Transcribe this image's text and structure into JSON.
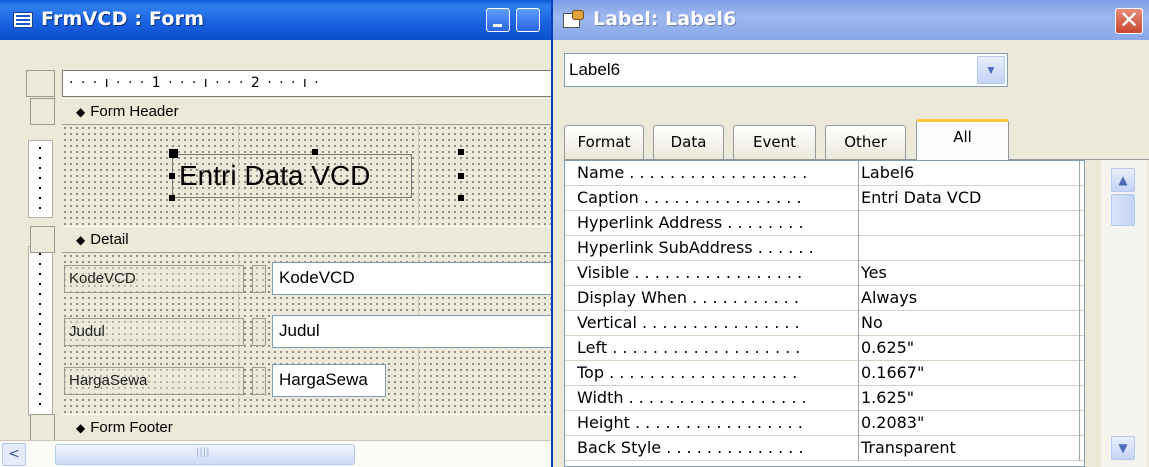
{
  "form_window": {
    "title": "FrmVCD : Form",
    "ruler_text": "· · · ı · · · 1 · · · ı · · · 2 · · · ı ·",
    "sections": {
      "header": "Form Header",
      "detail": "Detail",
      "footer": "Form Footer"
    },
    "header_label": "Entri Data VCD",
    "fields": [
      {
        "label": "KodeVCD",
        "textbox": "KodeVCD"
      },
      {
        "label": "Judul",
        "textbox": "Judul"
      },
      {
        "label": "HargaSewa",
        "textbox": "HargaSewa"
      }
    ],
    "section_arrow": "◆",
    "scroll_left": "<"
  },
  "property_sheet": {
    "title": "Label: Label6",
    "close_glyph": "✕",
    "selected_object": "Label6",
    "tabs": [
      "Format",
      "Data",
      "Event",
      "Other",
      "All"
    ],
    "active_tab": "All",
    "properties": [
      {
        "name": "Name . . . . . . . . . . . . . . . . . .",
        "value": "Label6"
      },
      {
        "name": "Caption . . . . . . . . . . . . . . . .",
        "value": "Entri Data VCD"
      },
      {
        "name": "Hyperlink Address . . . . . . . .",
        "value": ""
      },
      {
        "name": "Hyperlink SubAddress . . . . . .",
        "value": ""
      },
      {
        "name": "Visible . . . . . . . . . . . . . . . . .",
        "value": "Yes"
      },
      {
        "name": "Display When . . . . . . . . . . .",
        "value": "Always"
      },
      {
        "name": "Vertical . . . . . . . . . . . . . . . .",
        "value": "No"
      },
      {
        "name": "Left . . . . . . . . . . . . . . . . . . .",
        "value": "0.625\""
      },
      {
        "name": "Top . . . . . . . . . . . . . . . . . . .",
        "value": "0.1667\""
      },
      {
        "name": "Width . . . . . . . . . . . . . . . . . .",
        "value": "1.625\""
      },
      {
        "name": "Height . . . . . . . . . . . . . . . . .",
        "value": "0.2083\""
      },
      {
        "name": "Back Style . . . . . . . . . . . . . .",
        "value": "Transparent"
      }
    ],
    "scroll_up": "▲",
    "scroll_down": "▼",
    "dropdown_arrow": "▼"
  },
  "colors": {
    "active_titlebar": "#1960e0",
    "inactive_titlebar": "#8aa8ea",
    "tab_highlight": "#ffc83c",
    "face": "#ece9d8"
  }
}
